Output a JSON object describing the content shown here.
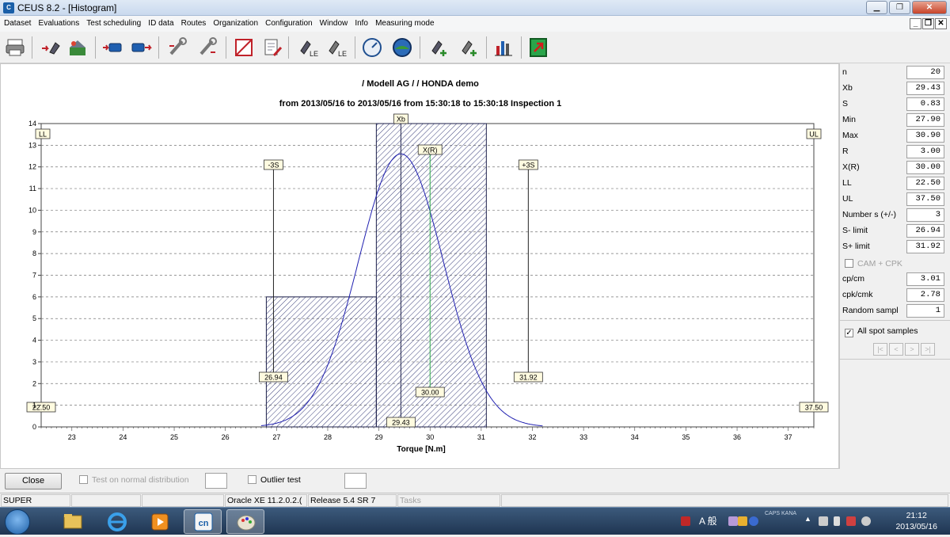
{
  "window": {
    "title": "CEUS 8.2 - [Histogram]",
    "app_icon_text": "CEUS"
  },
  "menu": [
    "Dataset",
    "Evaluations",
    "Test scheduling",
    "ID data",
    "Routes",
    "Organization",
    "Configuration",
    "Window",
    "Info",
    "Measuring mode"
  ],
  "toolbar_icons": [
    "printer-icon",
    "add-tool-icon",
    "scene-icon",
    "battery-in-icon",
    "battery-out-icon",
    "wrench-in-icon",
    "wrench-out-icon",
    "graph-frame-icon",
    "document-pen-icon",
    "tool-le-icon",
    "tool-le-2-icon",
    "speed-gauge-icon",
    "globe-gauge-icon",
    "tool-plus-icon",
    "tool-plus-2-icon",
    "bar-chart-icon",
    "exit-icon"
  ],
  "chart": {
    "title": "/ Modell AG / / HONDA demo",
    "subtitle": "from 2013/05/16 to 2013/05/16  from 15:30:18 to 15:30:18   Inspection 1",
    "xlabel": "Torque [N.m]"
  },
  "chart_data": {
    "type": "bar",
    "title": "/ Modell AG / / HONDA demo",
    "subtitle": "from 2013/05/16 to 2013/05/16  from 15:30:18 to 15:30:18   Inspection 1",
    "xlabel": "Torque [N.m]",
    "ylabel": "",
    "xlim": [
      22.4,
      37.5
    ],
    "ylim": [
      0,
      14
    ],
    "xticks": [
      23,
      24,
      25,
      26,
      27,
      28,
      29,
      30,
      31,
      32,
      33,
      34,
      35,
      36,
      37
    ],
    "yticks": [
      0,
      1,
      2,
      3,
      4,
      5,
      6,
      7,
      8,
      9,
      10,
      11,
      12,
      13,
      14
    ],
    "grid": "horizontal dashed",
    "bins": [
      {
        "from": 26.8,
        "to": 28.95,
        "count": 6
      },
      {
        "from": 28.95,
        "to": 31.1,
        "count": 14
      }
    ],
    "normal_curve": {
      "mean": 29.43,
      "sd": 0.83,
      "peak": 12.6,
      "color": "#2020b0"
    },
    "markers": [
      {
        "label": "LL",
        "x": 22.5,
        "value_label": "22.50"
      },
      {
        "label": "-3S",
        "x": 26.94,
        "value_label": "26.94"
      },
      {
        "label": "Xb",
        "x": 29.43,
        "value_label": "29.43"
      },
      {
        "label": "X(R)",
        "x": 30.0,
        "value_label": "30.00"
      },
      {
        "label": "+3S",
        "x": 31.92,
        "value_label": "31.92"
      },
      {
        "label": "UL",
        "x": 37.5,
        "value_label": "37.50"
      }
    ],
    "xr_line_color": "#2ea84a"
  },
  "stats": [
    {
      "label": "n",
      "value": "20"
    },
    {
      "label": "Xb",
      "value": "29.43"
    },
    {
      "label": "S",
      "value": "0.83"
    },
    {
      "label": "Min",
      "value": "27.90"
    },
    {
      "label": "Max",
      "value": "30.90"
    },
    {
      "label": "R",
      "value": "3.00"
    },
    {
      "label": "X(R)",
      "value": "30.00"
    },
    {
      "label": "LL",
      "value": "22.50"
    },
    {
      "label": "UL",
      "value": "37.50"
    },
    {
      "label": "Number s (+/-)",
      "value": "3"
    },
    {
      "label": "S- limit",
      "value": "26.94"
    },
    {
      "label": "S+ limit",
      "value": "31.92"
    }
  ],
  "cam_cpk": {
    "label": "CAM + CPK",
    "checked": false
  },
  "stats2": [
    {
      "label": "cp/cm",
      "value": "3.01"
    },
    {
      "label": "cpk/cmk",
      "value": "2.78"
    },
    {
      "label": "Random sampl",
      "value": "1"
    }
  ],
  "spot_samples": {
    "label": "All spot samples",
    "checked": true,
    "nav": [
      "|<",
      "<",
      ">",
      ">|"
    ]
  },
  "bottom": {
    "close_label": "Close",
    "normal_test_label": "Test on normal distribution",
    "outlier_label": "Outlier test"
  },
  "status": {
    "user": "SUPER",
    "db": "Oracle XE 11.2.0.2.(",
    "release": "Release 5.4 SR 7",
    "tasks": "Tasks"
  },
  "taskbar": {
    "ime": "A 般",
    "caps": "CAPS\nKANA",
    "time": "21:12",
    "date": "2013/05/16"
  }
}
